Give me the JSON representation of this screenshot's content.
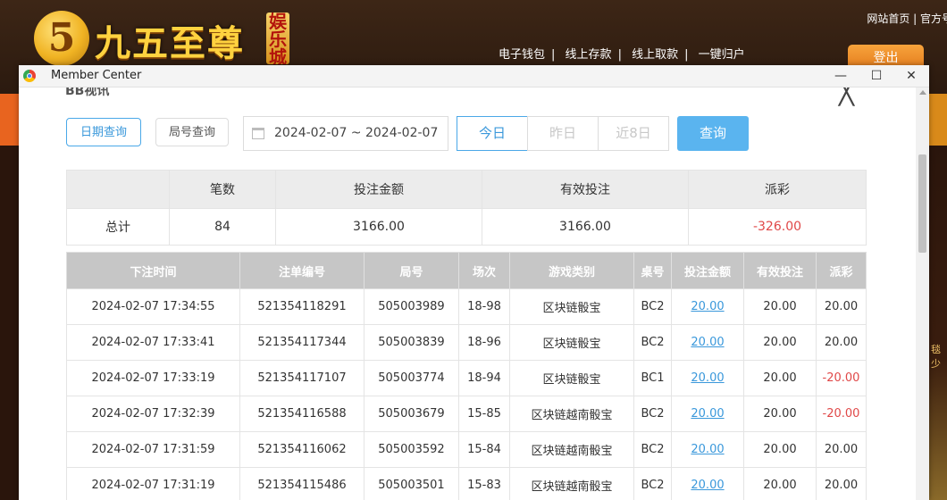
{
  "site": {
    "logo_glyph": "5",
    "logo_text": "九五至尊",
    "logo_sub": "娱乐城",
    "top_links": "网站首页 | 官方号",
    "nav": [
      "电子钱包",
      "线上存款",
      "线上取款",
      "一键归户"
    ],
    "logout": "登出",
    "side_hint": "毯少"
  },
  "window": {
    "title": "Member Center",
    "minimize": "—",
    "maximize": "☐",
    "close": "✕"
  },
  "page": {
    "section_title": "BB视讯",
    "close_glyph": "╳",
    "query_buttons": [
      "日期查询",
      "局号查询"
    ],
    "date_range": "2024-02-07 ~ 2024-02-07",
    "quick_ranges": [
      "今日",
      "昨日",
      "近8日"
    ],
    "search": "查询"
  },
  "summary": {
    "headers": [
      "",
      "笔数",
      "投注金额",
      "有效投注",
      "派彩"
    ],
    "row": [
      "总计",
      "84",
      "3166.00",
      "3166.00",
      "-326.00"
    ]
  },
  "detail": {
    "headers": [
      "下注时间",
      "注单编号",
      "局号",
      "场次",
      "游戏类别",
      "桌号",
      "投注金额",
      "有效投注",
      "派彩"
    ],
    "rows": [
      [
        "2024-02-07 17:34:55",
        "521354118291",
        "505003989",
        "18-98",
        "区块链骰宝",
        "BC2",
        "20.00",
        "20.00",
        "20.00"
      ],
      [
        "2024-02-07 17:33:41",
        "521354117344",
        "505003839",
        "18-96",
        "区块链骰宝",
        "BC2",
        "20.00",
        "20.00",
        "20.00"
      ],
      [
        "2024-02-07 17:33:19",
        "521354117107",
        "505003774",
        "18-94",
        "区块链骰宝",
        "BC1",
        "20.00",
        "20.00",
        "-20.00"
      ],
      [
        "2024-02-07 17:32:39",
        "521354116588",
        "505003679",
        "15-85",
        "区块链越南骰宝",
        "BC2",
        "20.00",
        "20.00",
        "-20.00"
      ],
      [
        "2024-02-07 17:31:59",
        "521354116062",
        "505003592",
        "15-84",
        "区块链越南骰宝",
        "BC2",
        "20.00",
        "20.00",
        "20.00"
      ],
      [
        "2024-02-07 17:31:19",
        "521354115486",
        "505003501",
        "15-83",
        "区块链越南骰宝",
        "BC2",
        "20.00",
        "20.00",
        "20.00"
      ]
    ]
  },
  "colors": {
    "accent": "#3a98db",
    "negative": "#e04848",
    "header_gray": "#c6c6c6"
  }
}
